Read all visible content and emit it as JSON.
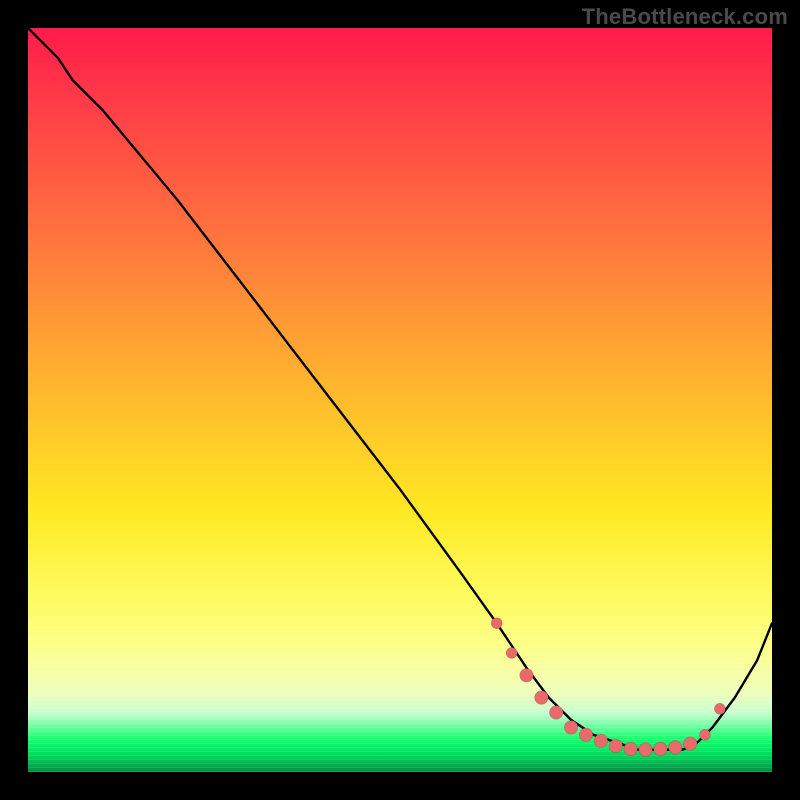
{
  "watermark": "TheBottleneck.com",
  "chart_data": {
    "type": "line",
    "title": "",
    "xlabel": "",
    "ylabel": "",
    "xlim": [
      0,
      100
    ],
    "ylim": [
      0,
      100
    ],
    "grid": false,
    "legend": false,
    "series": [
      {
        "name": "curve",
        "x": [
          0,
          4,
          6,
          10,
          20,
          30,
          40,
          50,
          58,
          63,
          65,
          67,
          70,
          73,
          76,
          79,
          82,
          85,
          88,
          90,
          92,
          95,
          98,
          100
        ],
        "y": [
          100,
          96,
          93,
          89,
          77,
          64,
          51,
          38,
          27,
          20,
          17,
          14,
          10,
          7,
          5,
          4,
          3,
          3,
          3,
          4,
          6,
          10,
          15,
          20
        ]
      }
    ],
    "highlight_points": {
      "name": "dots",
      "x": [
        63,
        65,
        67,
        69,
        71,
        73,
        75,
        77,
        79,
        81,
        83,
        85,
        87,
        89,
        91,
        93
      ],
      "y": [
        20,
        16,
        13,
        10,
        8,
        6,
        5,
        4.2,
        3.5,
        3.1,
        3.0,
        3.1,
        3.3,
        3.8,
        5.0,
        8.5
      ]
    },
    "colors": {
      "curve": "#000000",
      "dots": "#e86a6a",
      "gradient_top": "#ff1b4b",
      "gradient_mid": "#ffe922",
      "gradient_green": "#19ff72"
    }
  }
}
